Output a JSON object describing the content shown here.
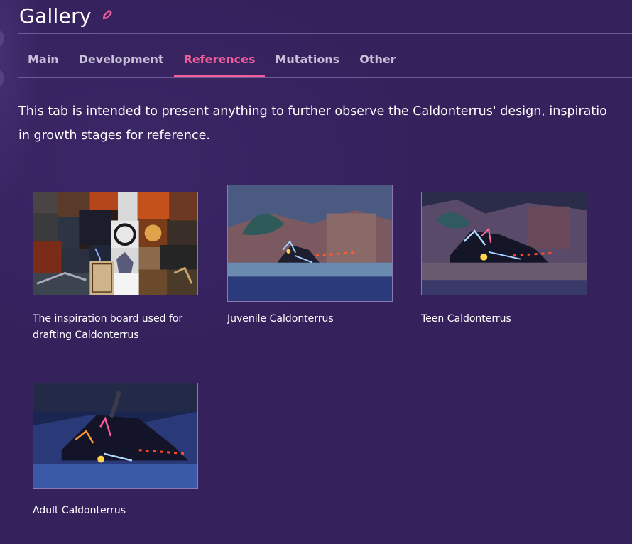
{
  "header": {
    "title": "Gallery",
    "edit_icon": "pencil-icon",
    "accent_color": "#f15f9a"
  },
  "tabs": [
    {
      "label": "Main",
      "active": false
    },
    {
      "label": "Development",
      "active": false
    },
    {
      "label": "References",
      "active": true
    },
    {
      "label": "Mutations",
      "active": false
    },
    {
      "label": "Other",
      "active": false
    }
  ],
  "intro": {
    "line1": "This tab is intended to present anything to further observe the Caldonterrus' design, inspiratio",
    "line2": "in growth stages for reference."
  },
  "gallery": {
    "items": [
      {
        "caption_line1": "The inspiration board used for",
        "caption_line2": "drafting Caldonterrus"
      },
      {
        "caption_line1": "Juvenile Caldonterrus",
        "caption_line2": ""
      },
      {
        "caption_line1": "Teen Caldonterrus",
        "caption_line2": ""
      },
      {
        "caption_line1": "Adult Caldonterrus",
        "caption_line2": ""
      }
    ]
  }
}
